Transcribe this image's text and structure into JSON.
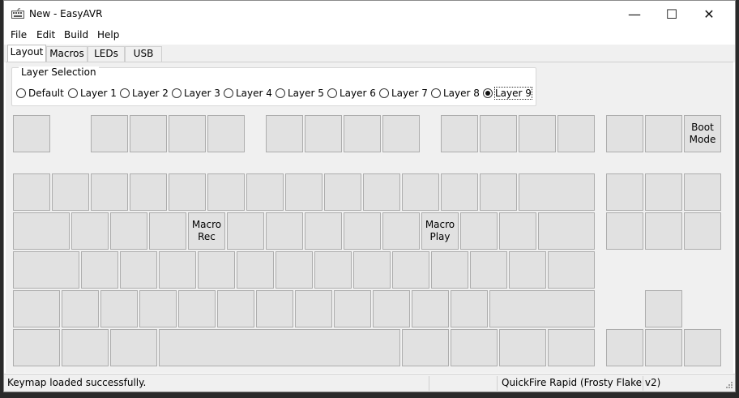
{
  "window": {
    "title": "New - EasyAVR",
    "minimize_glyph": "—",
    "maximize_glyph": "☐",
    "close_glyph": "✕"
  },
  "menu": {
    "file": "File",
    "edit": "Edit",
    "build": "Build",
    "help": "Help"
  },
  "tabs": {
    "layout": "Layout",
    "macros": "Macros",
    "leds": "LEDs",
    "usb": "USB"
  },
  "layer_selection": {
    "label": "Layer Selection",
    "options": [
      "Default",
      "Layer 1",
      "Layer 2",
      "Layer 3",
      "Layer 4",
      "Layer 5",
      "Layer 6",
      "Layer 7",
      "Layer 8",
      "Layer 9"
    ],
    "selected": "Layer 9"
  },
  "keys": {
    "boot_mode": "Boot\nMode",
    "macro_rec": "Macro\nRec",
    "macro_play": "Macro\nPlay"
  },
  "status": {
    "message": "Keymap loaded successfully.",
    "keyboard": "QuickFire Rapid (Frosty Flake v2)"
  },
  "colors": {
    "key_fill": "#e1e1e1",
    "key_border": "#adadad",
    "panel": "#f0f0f0"
  }
}
